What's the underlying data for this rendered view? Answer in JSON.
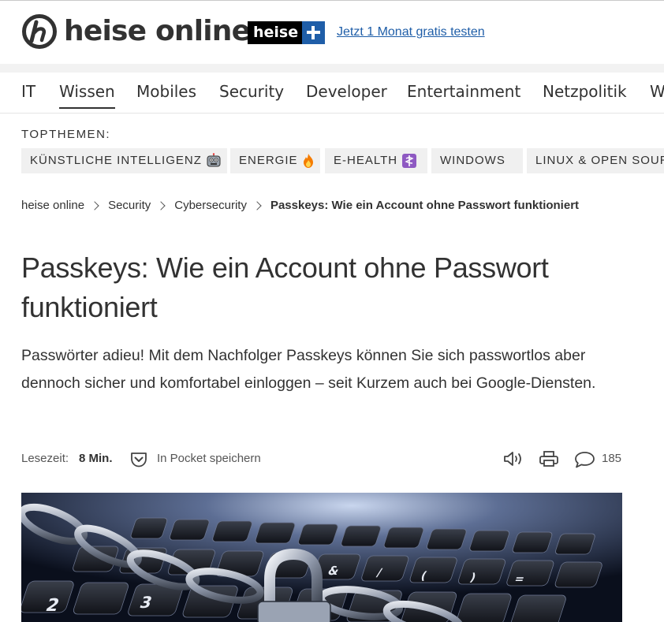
{
  "header": {
    "logo_text": "heise online",
    "plus_word": "heise",
    "trial_link": "Jetzt 1 Monat gratis testen",
    "brand_color": "#1f5ea8"
  },
  "nav": {
    "items": [
      "IT",
      "Wissen",
      "Mobiles",
      "Security",
      "Developer",
      "Entertainment",
      "Netzpolitik",
      "W"
    ],
    "active": "Wissen"
  },
  "topthemen": {
    "label": "TOPTHEMEN:",
    "chips": [
      {
        "label": "KÜNSTLICHE INTELLIGENZ",
        "icon": "robot-icon"
      },
      {
        "label": "ENERGIE",
        "icon": "fire-icon"
      },
      {
        "label": "E-HEALTH",
        "icon": "medical-icon"
      },
      {
        "label": "WINDOWS",
        "icon": ""
      },
      {
        "label": "LINUX & OPEN SOUR",
        "icon": ""
      }
    ]
  },
  "breadcrumb": {
    "items": [
      "heise online",
      "Security",
      "Cybersecurity"
    ],
    "current": "Passkeys: Wie ein Account ohne Passwort funktioniert"
  },
  "article": {
    "title": "Passkeys: Wie ein Account ohne Passwort funktioniert",
    "lead": "Passwörter adieu! Mit dem Nachfolger Passkeys können Sie sich passwortlos aber dennoch sicher und komfortabel einloggen – seit Kurzem auch bei Google-Diensten.",
    "readtime_label": "Lesezeit:",
    "readtime_value": "8 Min.",
    "pocket_label": "In Pocket speichern",
    "comment_count": "185"
  }
}
